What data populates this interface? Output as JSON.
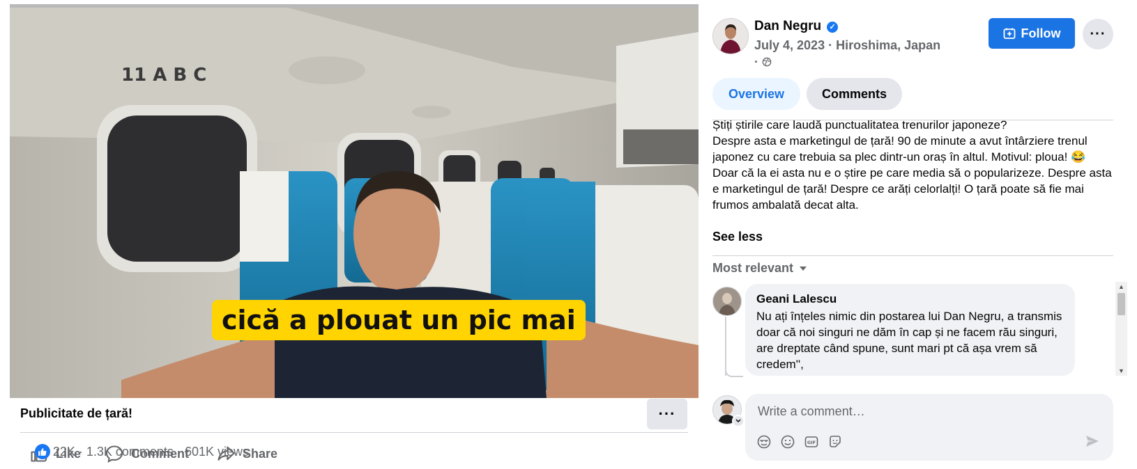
{
  "video": {
    "caption": "cică a plouat un pic mai",
    "title": "Publicitate de țară!",
    "more_label": "···"
  },
  "actions": {
    "like": "Like",
    "comment": "Comment",
    "share": "Share"
  },
  "stats": {
    "reactions": "22K",
    "comments": "1.3K comments",
    "views": "601K views",
    "separator": "·"
  },
  "author": {
    "name": "Dan Negru",
    "date": "July 4, 2023",
    "location": "Hiroshima, Japan",
    "meta_separator": "·",
    "follow_label": "Follow",
    "more_label": "···"
  },
  "tabs": [
    {
      "label": "Overview",
      "active": true
    },
    {
      "label": "Comments",
      "active": false
    }
  ],
  "post": {
    "text_lines": [
      "Știți știrile care laudă punctualitatea trenurilor japoneze?",
      "Despre asta e marketingul de țară! 90 de minute a avut întârziere trenul japonez cu care trebuia sa plec dintr-un oraș în altul. Motivul: ploua! 😂",
      "Doar că la ei asta nu e o știre pe care media să o popularizeze. Despre asta e marketingul de țară! Despre ce arăți celorlalți! O țară poate să fie mai frumos ambalată decat alta."
    ],
    "see_less": "See less"
  },
  "comments": {
    "sort_label": "Most relevant",
    "items": [
      {
        "author": "Geani Lalescu",
        "text": "Nu ați înțeles nimic din postarea lui Dan Negru, a transmis doar că noi singuri ne dăm în cap și ne facem rău singuri, are dreptate când spune, sunt mari pt că așa vrem să credem'',"
      }
    ],
    "write_placeholder": "Write a comment…"
  },
  "colors": {
    "accent": "#1b74e4",
    "caption_bg": "#ffd400",
    "secondary_text": "#65676b"
  }
}
